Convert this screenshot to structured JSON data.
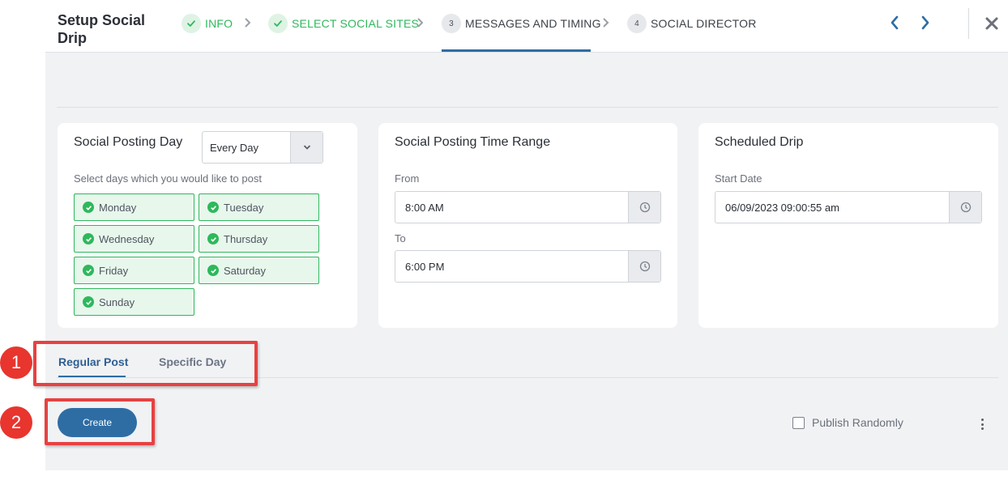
{
  "header": {
    "title": "Setup Social Drip",
    "steps": [
      {
        "label": "INFO",
        "state": "done"
      },
      {
        "label": "SELECT SOCIAL SITES",
        "state": "done"
      },
      {
        "label": "MESSAGES AND TIMING",
        "number": "3",
        "state": "active"
      },
      {
        "label": "SOCIAL DIRECTOR",
        "number": "4",
        "state": "pending"
      }
    ],
    "prev_icon": "chevron-left-icon",
    "next_icon": "chevron-right-icon",
    "close_icon": "close-icon"
  },
  "posting_day": {
    "title": "Social Posting Day",
    "select_value": "Every Day",
    "helper": "Select days which you would like to post",
    "days": [
      "Monday",
      "Tuesday",
      "Wednesday",
      "Thursday",
      "Friday",
      "Saturday",
      "Sunday"
    ]
  },
  "time_range": {
    "title": "Social Posting Time Range",
    "from_label": "From",
    "from_value": "8:00 AM",
    "to_label": "To",
    "to_value": "6:00 PM"
  },
  "scheduled": {
    "title": "Scheduled Drip",
    "start_label": "Start Date",
    "start_value": "06/09/2023 09:00:55 am"
  },
  "tabs": {
    "regular": "Regular Post",
    "specific": "Specific Day"
  },
  "actions": {
    "create": "Create",
    "publish_randomly": "Publish Randomly"
  },
  "annotations": {
    "marker1": "1",
    "marker2": "2"
  },
  "colors": {
    "accent": "#2e6da4",
    "success": "#2eb85c",
    "annotation": "#e8352e"
  }
}
